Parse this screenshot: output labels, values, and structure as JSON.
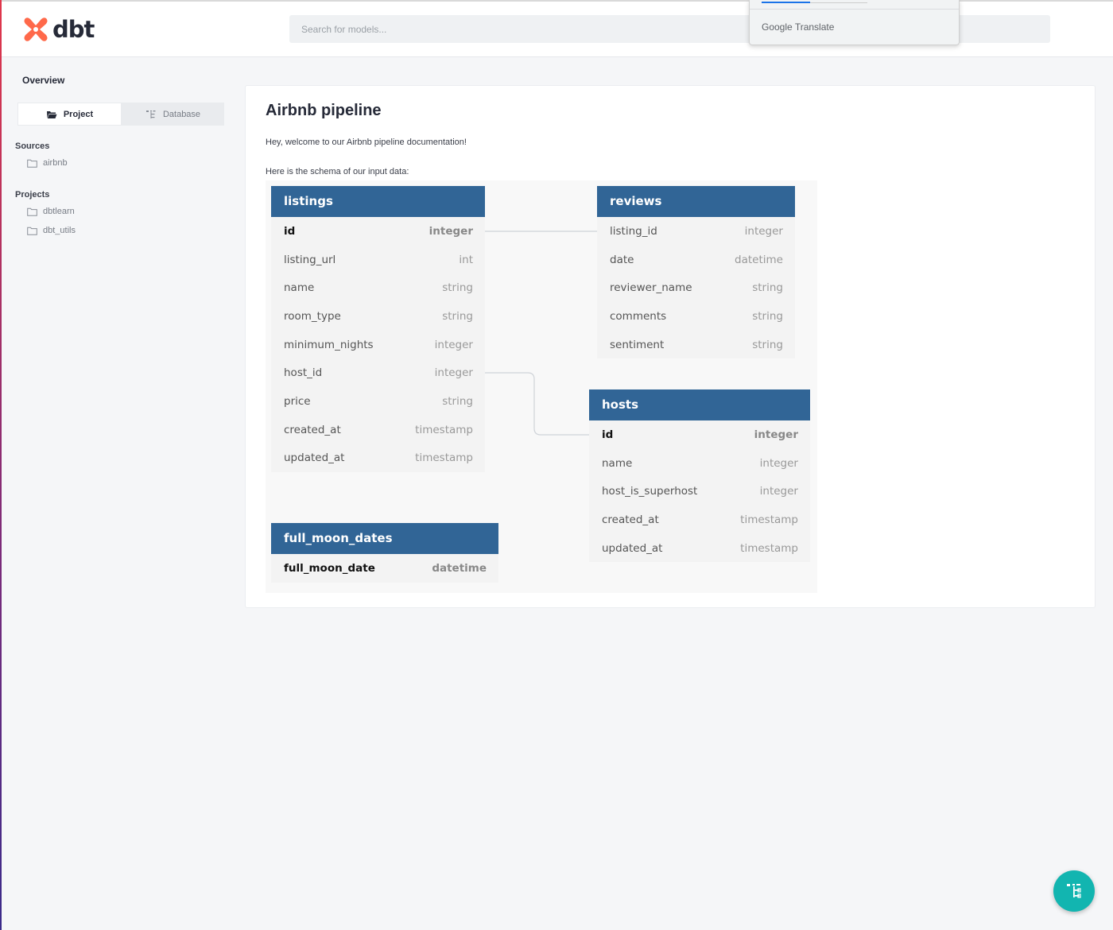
{
  "header": {
    "logo_text": "dbt",
    "search_placeholder": "Search for models..."
  },
  "translate_popup": {
    "brand_google": "Google",
    "brand_translate": "Translate"
  },
  "sidebar": {
    "overview_label": "Overview",
    "tabs": [
      {
        "label": "Project",
        "icon": "folder-open-icon",
        "active": true
      },
      {
        "label": "Database",
        "icon": "tree-icon",
        "active": false
      }
    ],
    "sources_title": "Sources",
    "sources": [
      "airbnb"
    ],
    "projects_title": "Projects",
    "projects": [
      "dbtlearn",
      "dbt_utils"
    ]
  },
  "main": {
    "title": "Airbnb pipeline",
    "intro": "Hey, welcome to our Airbnb pipeline documentation!",
    "schema_intro": "Here is the schema of our input data:"
  },
  "schema": {
    "colors": {
      "header_bg": "#316596",
      "row_bg": "#f3f3f3"
    },
    "tables": {
      "listings": {
        "name": "listings",
        "columns": [
          {
            "name": "id",
            "type": "integer",
            "pk": true
          },
          {
            "name": "listing_url",
            "type": "int"
          },
          {
            "name": "name",
            "type": "string"
          },
          {
            "name": "room_type",
            "type": "string"
          },
          {
            "name": "minimum_nights",
            "type": "integer"
          },
          {
            "name": "host_id",
            "type": "integer"
          },
          {
            "name": "price",
            "type": "string"
          },
          {
            "name": "created_at",
            "type": "timestamp"
          },
          {
            "name": "updated_at",
            "type": "timestamp"
          }
        ]
      },
      "reviews": {
        "name": "reviews",
        "columns": [
          {
            "name": "listing_id",
            "type": "integer"
          },
          {
            "name": "date",
            "type": "datetime"
          },
          {
            "name": "reviewer_name",
            "type": "string"
          },
          {
            "name": "comments",
            "type": "string"
          },
          {
            "name": "sentiment",
            "type": "string"
          }
        ]
      },
      "hosts": {
        "name": "hosts",
        "columns": [
          {
            "name": "id",
            "type": "integer",
            "pk": true
          },
          {
            "name": "name",
            "type": "integer"
          },
          {
            "name": "host_is_superhost",
            "type": "integer"
          },
          {
            "name": "created_at",
            "type": "timestamp"
          },
          {
            "name": "updated_at",
            "type": "timestamp"
          }
        ]
      },
      "full_moon_dates": {
        "name": "full_moon_dates",
        "columns": [
          {
            "name": "full_moon_date",
            "type": "datetime",
            "pk": true
          }
        ]
      }
    }
  },
  "fab": {
    "icon": "lineage-graph-icon",
    "color": "#12b5b0"
  }
}
